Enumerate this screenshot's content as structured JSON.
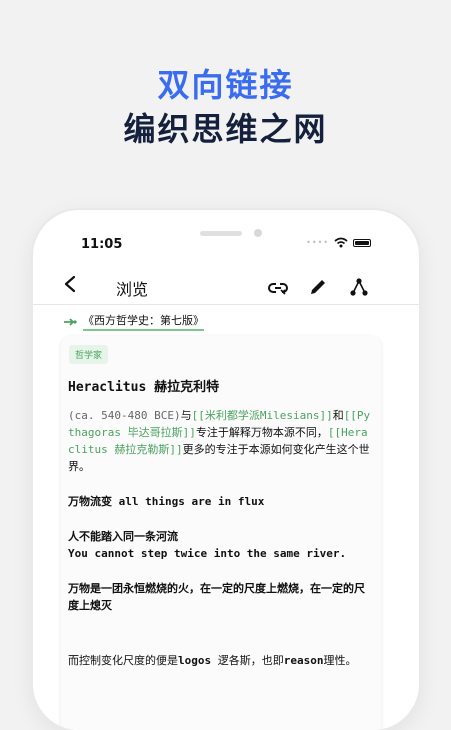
{
  "promo": {
    "line1": "双向链接",
    "line2": "编织思维之网"
  },
  "status": {
    "time": "11:05",
    "signal_dots": "••••"
  },
  "nav": {
    "back": "<",
    "title": "浏览"
  },
  "breadcrumb": {
    "text": "《西方哲学史：第七版》"
  },
  "card": {
    "tag": "哲学家",
    "heading": "Heraclitus 赫拉克利特",
    "intro": {
      "dates": "(ca. 540-480 BCE)",
      "t1": "与",
      "link1": "[[米利都学派Milesians]]",
      "t2": "和",
      "link2": "[[Pythagoras 毕达哥拉斯]]",
      "t3": "专注于解释万物本源不同，",
      "link3": "[[Heraclitus 赫拉克勒斯]]",
      "t4": "更多的专注于本源如何变化产生这个世界。"
    },
    "p2_a": "万物流变 ",
    "p2_b": "all things are in flux",
    "p3_a": "人不能踏入同一条河流",
    "p3_b": "You cannot step twice into the same river.",
    "p4": "万物是一团永恒燃烧的火，在一定的尺度上燃烧，在一定的尺度上熄灭",
    "p5_a": "而控制变化尺度的便是",
    "p5_b": "logos",
    "p5_c": " 逻各斯，也即",
    "p5_d": "reason",
    "p5_e": "理性。"
  },
  "colors": {
    "accent_blue": "#3a6cf0",
    "heading_dark": "#15203c",
    "link_green": "#4aa35e"
  },
  "icons": [
    "back-arrow-icon",
    "link-icon",
    "pencil-icon",
    "graph-icon",
    "wifi-icon",
    "battery-icon",
    "connection-icon"
  ]
}
